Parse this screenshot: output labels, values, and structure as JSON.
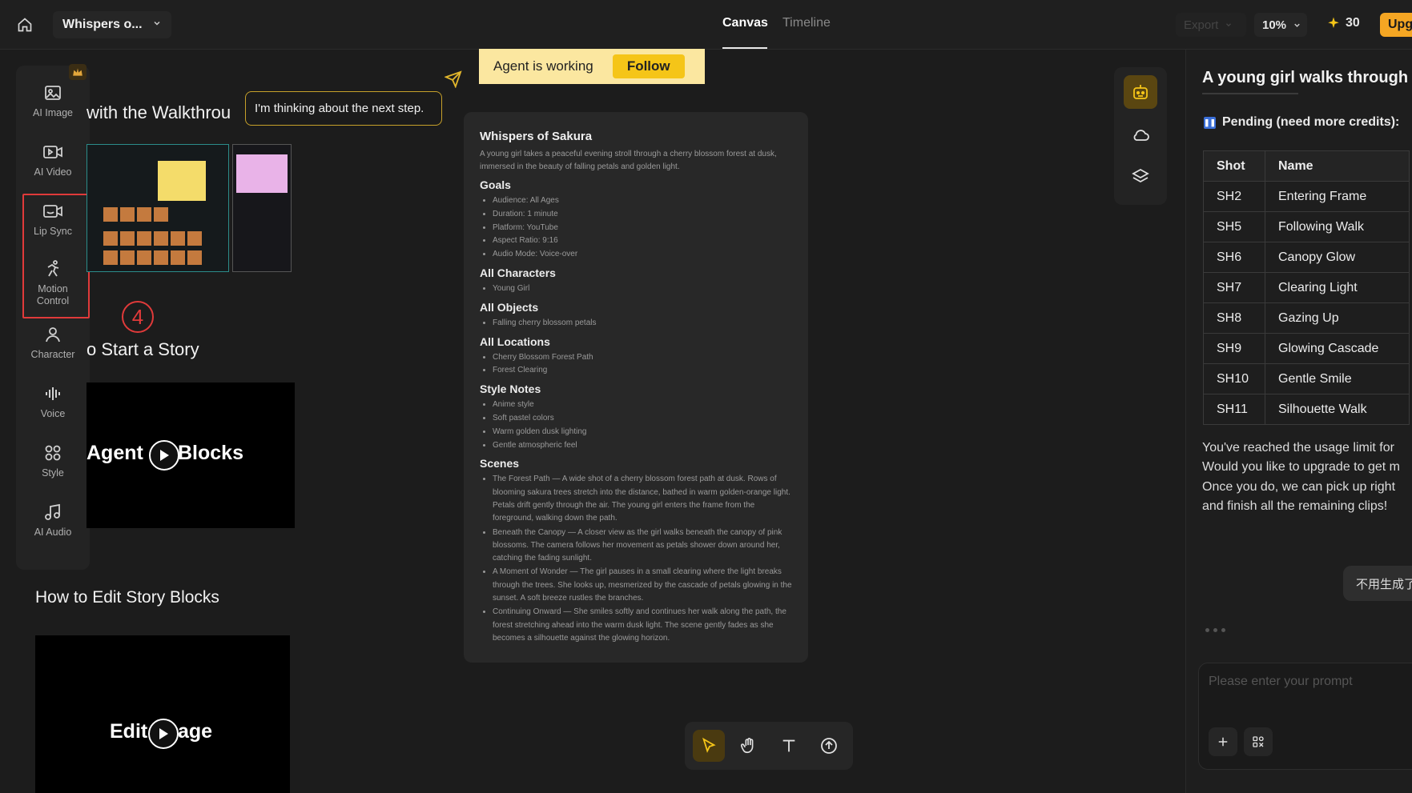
{
  "topbar": {
    "project_name": "Whispers o...",
    "tabs": {
      "canvas": "Canvas",
      "timeline": "Timeline"
    },
    "export_label": "Export",
    "zoom": "10%",
    "credits": "30",
    "upgrade_label": "Upg"
  },
  "sidebar": {
    "items": [
      {
        "label": "AI Image",
        "icon": "ai-image-icon"
      },
      {
        "label": "AI Video",
        "icon": "ai-video-icon"
      },
      {
        "label": "Lip Sync",
        "icon": "lip-sync-icon"
      },
      {
        "label": "Motion\nControl",
        "icon": "motion-control-icon"
      },
      {
        "label": "Character",
        "icon": "character-icon"
      },
      {
        "label": "Voice",
        "icon": "voice-icon"
      },
      {
        "label": "Style",
        "icon": "style-icon"
      },
      {
        "label": "AI Audio",
        "icon": "ai-audio-icon"
      }
    ],
    "step_number": "4"
  },
  "canvas": {
    "walkthrough_heading": "with the Walkthrou",
    "tooltip": "I'm thinking about the next step.",
    "start_story_heading": "o Start a Story",
    "video1_left": "Agent",
    "video1_right": "Blocks",
    "edit_heading": "How to Edit Story Blocks",
    "video2_left": "Edit",
    "video2_right": "age",
    "agent_status": "Agent is working",
    "follow_label": "Follow"
  },
  "document": {
    "title": "Whispers of Sakura",
    "intro": "A young girl takes a peaceful evening stroll through a cherry blossom forest at dusk, immersed in the beauty of falling petals and golden light.",
    "goals_heading": "Goals",
    "goals": [
      "Audience: All Ages",
      "Duration: 1 minute",
      "Platform: YouTube",
      "Aspect Ratio: 9:16",
      "Audio Mode: Voice-over"
    ],
    "characters_heading": "All Characters",
    "characters": [
      "Young Girl"
    ],
    "objects_heading": "All Objects",
    "objects": [
      "Falling cherry blossom petals"
    ],
    "locations_heading": "All Locations",
    "locations": [
      "Cherry Blossom Forest Path",
      "Forest Clearing"
    ],
    "style_heading": "Style Notes",
    "style_notes": [
      "Anime style",
      "Soft pastel colors",
      "Warm golden dusk lighting",
      "Gentle atmospheric feel"
    ],
    "scenes_heading": "Scenes",
    "scenes": [
      "The Forest Path — A wide shot of a cherry blossom forest path at dusk. Rows of blooming sakura trees stretch into the distance, bathed in warm golden-orange light. Petals drift gently through the air. The young girl enters the frame from the foreground, walking down the path.",
      "Beneath the Canopy — A closer view as the girl walks beneath the canopy of pink blossoms. The camera follows her movement as petals shower down around her, catching the fading sunlight.",
      "A Moment of Wonder — The girl pauses in a small clearing where the light breaks through the trees. She looks up, mesmerized by the cascade of petals glowing in the sunset. A soft breeze rustles the branches.",
      "Continuing Onward — She smiles softly and continues her walk along the path, the forest stretching ahead into the warm dusk light. The scene gently fades as she becomes a silhouette against the glowing horizon."
    ]
  },
  "chat": {
    "title": "A young girl walks through",
    "pending": "Pending (need more credits):",
    "columns": [
      "Shot",
      "Name"
    ],
    "rows": [
      [
        "SH2",
        "Entering Frame"
      ],
      [
        "SH5",
        "Following Walk"
      ],
      [
        "SH6",
        "Canopy Glow"
      ],
      [
        "SH7",
        "Clearing Light"
      ],
      [
        "SH8",
        "Gazing Up"
      ],
      [
        "SH9",
        "Glowing Cascade"
      ],
      [
        "SH10",
        "Gentle Smile"
      ],
      [
        "SH11",
        "Silhouette Walk"
      ]
    ],
    "usage_lines": [
      "You've reached the usage limit for",
      "Would you like to upgrade to get m",
      "Once you do, we can pick up right",
      "and finish all the remaining clips!"
    ],
    "user_chip": "不用生成了",
    "prompt_placeholder": "Please enter your prompt"
  },
  "colors": {
    "accent": "#f5c518",
    "highlight": "#e03a3a",
    "upgrade": "#f5a623"
  }
}
